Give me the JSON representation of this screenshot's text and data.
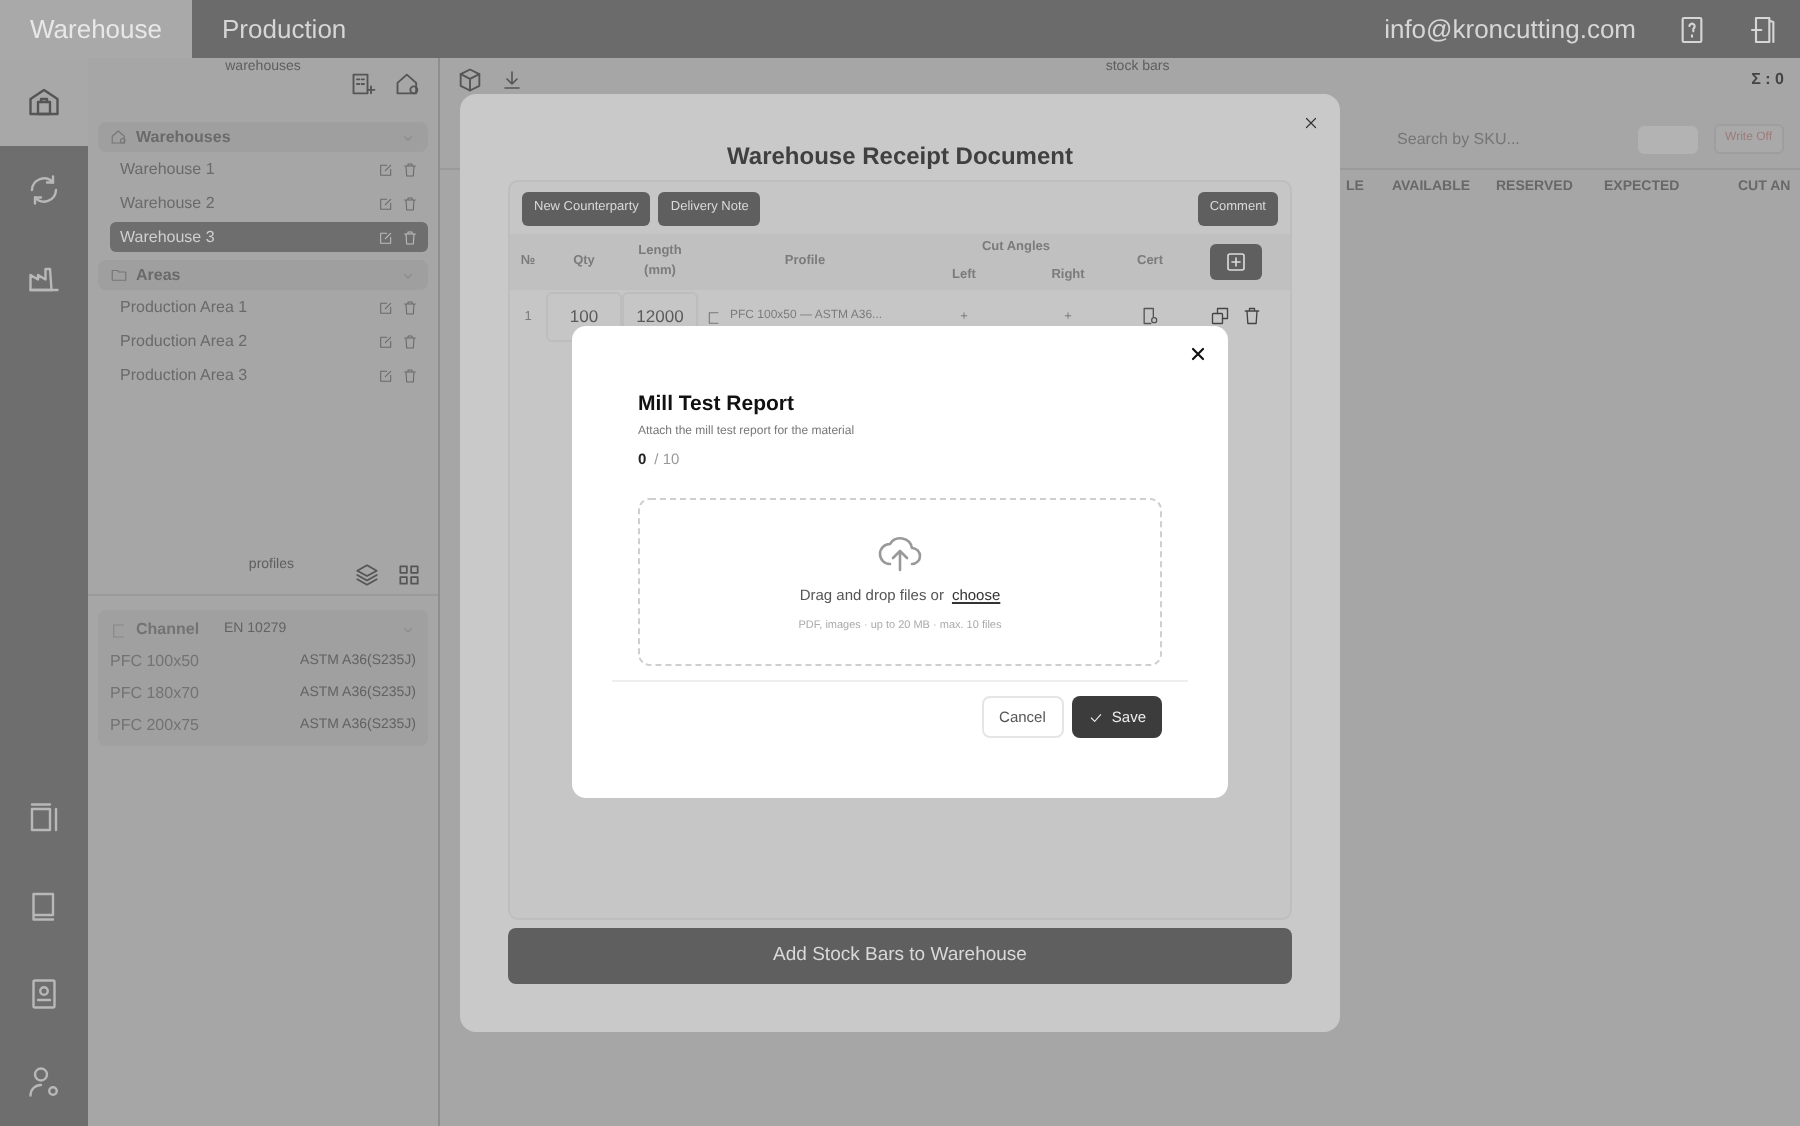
{
  "top_nav": {
    "tabs": [
      {
        "label": "Warehouse",
        "selected": true
      },
      {
        "label": "Production",
        "selected": false
      }
    ],
    "email": "info@kroncutting.com"
  },
  "icon_rail": {
    "items": [
      {
        "kind": "warehouse",
        "selected": true
      },
      {
        "kind": "cycle",
        "selected": false
      },
      {
        "kind": "factory",
        "selected": false
      },
      {
        "kind": "spacer"
      },
      {
        "kind": "layout",
        "selected": false
      },
      {
        "kind": "book",
        "selected": false
      },
      {
        "kind": "contacts",
        "selected": false
      },
      {
        "kind": "user-settings",
        "selected": false
      }
    ]
  },
  "sidebar": {
    "section_label": "warehouses",
    "groups": [
      {
        "kind": "warehouse",
        "title": "Warehouses",
        "expanded": true,
        "items": [
          {
            "label": "Warehouse 1",
            "selected": false
          },
          {
            "label": "Warehouse 2",
            "selected": false
          },
          {
            "label": "Warehouse 3",
            "selected": true
          }
        ]
      },
      {
        "kind": "area",
        "title": "Areas",
        "expanded": true,
        "items": [
          {
            "label": "Production Area 1",
            "selected": false
          },
          {
            "label": "Production Area 2",
            "selected": false
          },
          {
            "label": "Production Area 3",
            "selected": false
          }
        ]
      }
    ],
    "profiles_label": "profiles",
    "profile_group": {
      "title": "Channel",
      "standard": "EN 10279",
      "items": [
        {
          "name": "PFC 100x50",
          "grade": "ASTM A36(S235J)"
        },
        {
          "name": "PFC 180x70",
          "grade": "ASTM A36(S235J)"
        },
        {
          "name": "PFC 200x75",
          "grade": "ASTM A36(S235J)"
        }
      ]
    }
  },
  "main": {
    "section_label": "stock bars",
    "total": "Σ : 0",
    "search_placeholder": "Search by SKU...",
    "write_off": "Write Off",
    "columns": [
      "LE",
      "AVAILABLE",
      "RESERVED",
      "EXPECTED",
      "CUT AN"
    ]
  },
  "receipt_modal": {
    "title": "Warehouse Receipt Document",
    "buttons": [
      "New Counterparty",
      "Delivery Note"
    ],
    "comment": "Comment",
    "columns": {
      "no": "№",
      "qty": "Qty",
      "length": "Length (mm)",
      "profile": "Profile",
      "cut_angles": "Cut Angles",
      "left": "Left",
      "right": "Right",
      "cert": "Cert"
    },
    "rows": [
      {
        "no": "1",
        "qty": "100",
        "length": "12000",
        "profile": "PFC 100x50 — ASTM A36...",
        "left": "+",
        "right": "+"
      }
    ],
    "submit": "Add Stock Bars to Warehouse"
  },
  "cert_modal": {
    "title": "Mill Test Report",
    "subtitle": "Attach the mill test report for the material",
    "count": "0",
    "limit": "/ 10",
    "drop_text": "Drag and drop files or",
    "choose_link": "choose",
    "hint": "PDF, images · up to 20 MB · max. 10 files",
    "cancel": "Cancel",
    "save": "Save"
  }
}
